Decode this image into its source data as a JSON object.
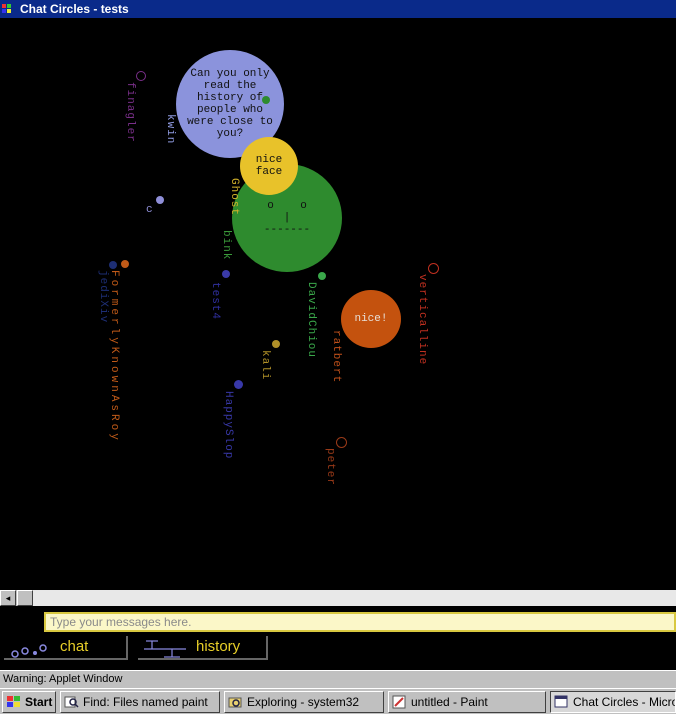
{
  "window": {
    "title": "Chat Circles - tests"
  },
  "stage": {
    "users": [
      {
        "name": "finagler",
        "color": "#7a2f8a"
      },
      {
        "name": "kwin",
        "color": "#8f9ae0"
      },
      {
        "name": "c",
        "color": "#8f8fd8"
      },
      {
        "name": "Ghost",
        "color": "#d0b02a"
      },
      {
        "name": "bink",
        "color": "#3a9a3a"
      },
      {
        "name": "jediXiv",
        "color": "#1d2e74"
      },
      {
        "name": "FormerlyKnownAsRoy",
        "color": "#c05a18"
      },
      {
        "name": "test4",
        "color": "#3030a0"
      },
      {
        "name": "DavidChiou",
        "color": "#3aa84a"
      },
      {
        "name": "ratbert",
        "color": "#c0501a"
      },
      {
        "name": "verticalline",
        "color": "#c03020"
      },
      {
        "name": "kali",
        "color": "#b09028"
      },
      {
        "name": "HappySlop",
        "color": "#3838a8"
      },
      {
        "name": "peter",
        "color": "#9a3a18"
      }
    ],
    "bubbles": [
      {
        "id": "blue",
        "text": "Can you only read the history of people who were close to you?",
        "color": "#8b93dc"
      },
      {
        "id": "yellow",
        "text": "nice face",
        "color": "#e8c22a"
      },
      {
        "id": "green",
        "text": "o    o\n|\n-------",
        "color": "#2e8b2e"
      },
      {
        "id": "orange",
        "text": "nice!",
        "color": "#c4520e"
      }
    ]
  },
  "scrollbar": {
    "left_arrow": "◂"
  },
  "message": {
    "placeholder": "Type your messages here."
  },
  "controls": {
    "chat_label": "chat",
    "history_label": "history"
  },
  "status": {
    "text": "Warning: Applet Window"
  },
  "taskbar": {
    "start": "Start",
    "items": [
      "Find: Files named paint",
      "Exploring - system32",
      "untitled - Paint",
      "Chat Circles - Microsof"
    ]
  }
}
